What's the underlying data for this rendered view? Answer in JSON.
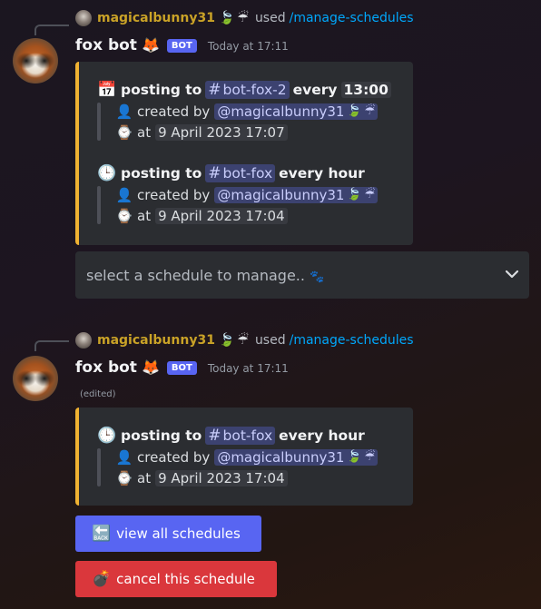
{
  "messages": [
    {
      "reply": {
        "username": "magicalbunny31",
        "deco1": "🍃",
        "deco2": "☔",
        "used": "used",
        "command": "/manage-schedules"
      },
      "author": "fox bot",
      "author_emoji": "🦊",
      "bot_tag": "BOT",
      "timestamp": "Today at 17:11",
      "schedules": [
        {
          "icon": "📅",
          "posting_to": "posting to",
          "channel": "bot-fox-2",
          "frequency": "every",
          "time": "13:00",
          "created_by": "created by",
          "user": "@magicalbunny31",
          "at": "at",
          "date": "9 April 2023 17:07"
        },
        {
          "icon": "🕒",
          "posting_to": "posting to",
          "channel": "bot-fox",
          "frequency": "every hour",
          "time": "",
          "created_by": "created by",
          "user": "@magicalbunny31",
          "at": "at",
          "date": "9 April 2023 17:04"
        }
      ],
      "select_placeholder": "select a schedule to manage..",
      "select_emoji": "🐾"
    },
    {
      "reply": {
        "username": "magicalbunny31",
        "deco1": "🍃",
        "deco2": "☔",
        "used": "used",
        "command": "/manage-schedules"
      },
      "author": "fox bot",
      "author_emoji": "🦊",
      "bot_tag": "BOT",
      "timestamp": "Today at 17:11",
      "edited": "(edited)",
      "schedules": [
        {
          "icon": "🕒",
          "posting_to": "posting to",
          "channel": "bot-fox",
          "frequency": "every hour",
          "time": "",
          "created_by": "created by",
          "user": "@magicalbunny31",
          "at": "at",
          "date": "9 April 2023 17:04"
        }
      ],
      "buttons": [
        {
          "icon": "🔙",
          "label": "view all schedules",
          "color": "#5865f2"
        },
        {
          "icon": "💣",
          "label": "cancel this schedule",
          "color": "#da373c"
        }
      ]
    }
  ],
  "icons": {
    "person": "👤",
    "watch": "⌚",
    "hash": "#",
    "chevron": "⌄"
  },
  "colors": {
    "accent_embed": "#f0b232",
    "username": "#c9a227",
    "command_link": "#00a8fc",
    "bot_tag": "#5865f2"
  }
}
